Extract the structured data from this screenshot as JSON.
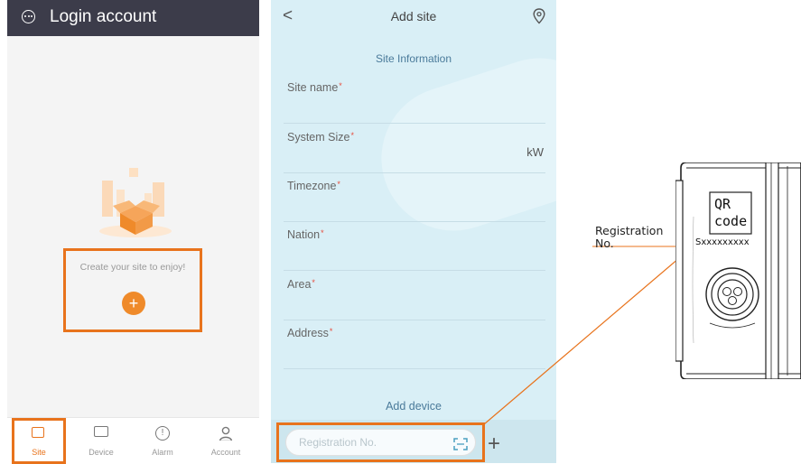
{
  "left": {
    "title": "Login account",
    "empty_prompt": "Create your site to enjoy!",
    "add_symbol": "+",
    "tabs": [
      {
        "label": "Site",
        "icon": "site-icon",
        "active": true
      },
      {
        "label": "Device",
        "icon": "device-icon",
        "active": false
      },
      {
        "label": "Alarm",
        "icon": "alarm-icon",
        "active": false
      },
      {
        "label": "Account",
        "icon": "account-icon",
        "active": false
      }
    ]
  },
  "middle": {
    "back_symbol": "<",
    "title": "Add site",
    "section_site_info": "Site Information",
    "fields": [
      {
        "label": "Site name",
        "required": "*",
        "unit": ""
      },
      {
        "label": "System Size",
        "required": "*",
        "unit": "kW"
      },
      {
        "label": "Timezone",
        "required": "*",
        "unit": ""
      },
      {
        "label": "Nation",
        "required": "*",
        "unit": ""
      },
      {
        "label": "Area",
        "required": "*",
        "unit": ""
      },
      {
        "label": "Address",
        "required": "*",
        "unit": ""
      }
    ],
    "section_add_device": "Add device",
    "registration_placeholder": "Registration No.",
    "add_symbol": "+"
  },
  "device": {
    "callout_line1": "Registration",
    "callout_line2": "No.",
    "qr_line1": "QR",
    "qr_line2": "code",
    "serial": "Sxxxxxxxxx"
  },
  "colors": {
    "highlight": "#e8731c",
    "header_dark": "#3c3c4a",
    "mid_background": "#d9eff6",
    "required": "#e74c3c",
    "fab": "#ef8a2a"
  }
}
